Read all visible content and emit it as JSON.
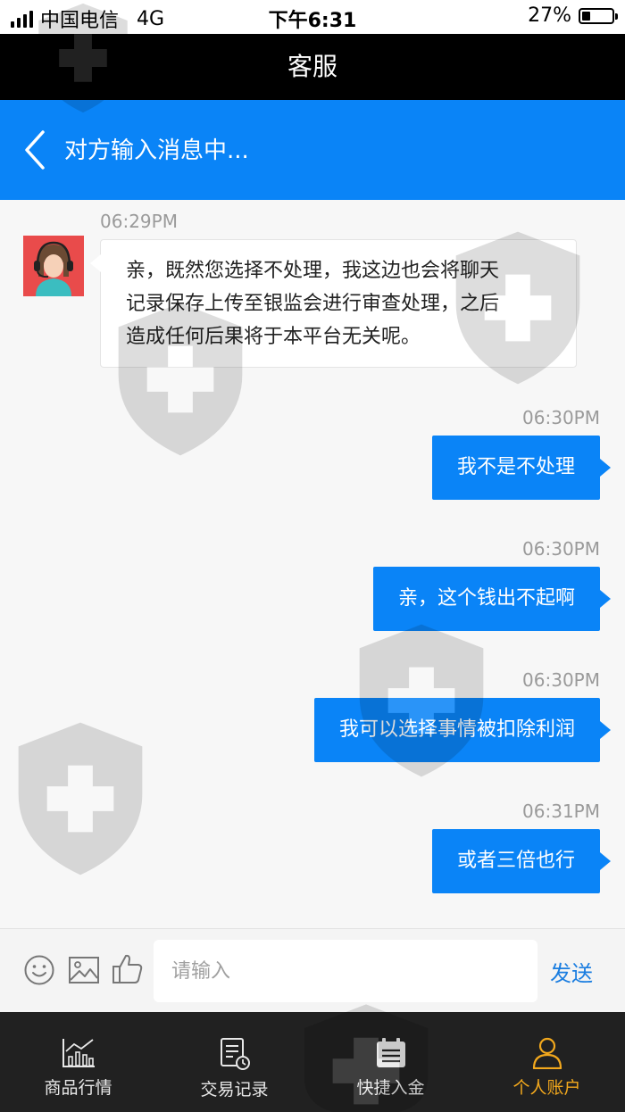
{
  "status_bar": {
    "carrier": "中国电信",
    "network": "4G",
    "time": "下午6:31",
    "battery_text": "27%",
    "battery_level": 0.27
  },
  "title_bar": {
    "title": "客服"
  },
  "header": {
    "status_text": "对方输入消息中..."
  },
  "messages": [
    {
      "time": "06:29PM",
      "from": "agent",
      "lines": [
        "亲，既然您选择不处理，我这边也会将聊天",
        "记录保存上传至银监会进行审查处理，之后",
        "造成任何后果将于本平台无关呢。"
      ]
    },
    {
      "time": "06:30PM",
      "from": "me",
      "text": "我不是不处理"
    },
    {
      "time": "06:30PM",
      "from": "me",
      "text": "亲，这个钱出不起啊"
    },
    {
      "time": "06:30PM",
      "from": "me",
      "text": "我可以选择事情被扣除利润"
    },
    {
      "time": "06:31PM",
      "from": "me",
      "text": "或者三倍也行"
    }
  ],
  "input_bar": {
    "placeholder": "请输入",
    "send_label": "发送",
    "icons": [
      "smiley-icon",
      "image-icon",
      "thumbs-up-icon"
    ]
  },
  "tabbar": {
    "items": [
      {
        "label": "商品行情",
        "icon": "chart-icon"
      },
      {
        "label": "交易记录",
        "icon": "record-icon"
      },
      {
        "label": "快捷入金",
        "icon": "calendar-icon"
      },
      {
        "label": "个人账户",
        "icon": "user-icon",
        "active": true
      }
    ]
  },
  "colors": {
    "header_blue": "#0a84f7",
    "outgoing_bubble": "#0a84f7",
    "active_tab": "#f2a81d",
    "tabbar_bg": "#212121"
  }
}
